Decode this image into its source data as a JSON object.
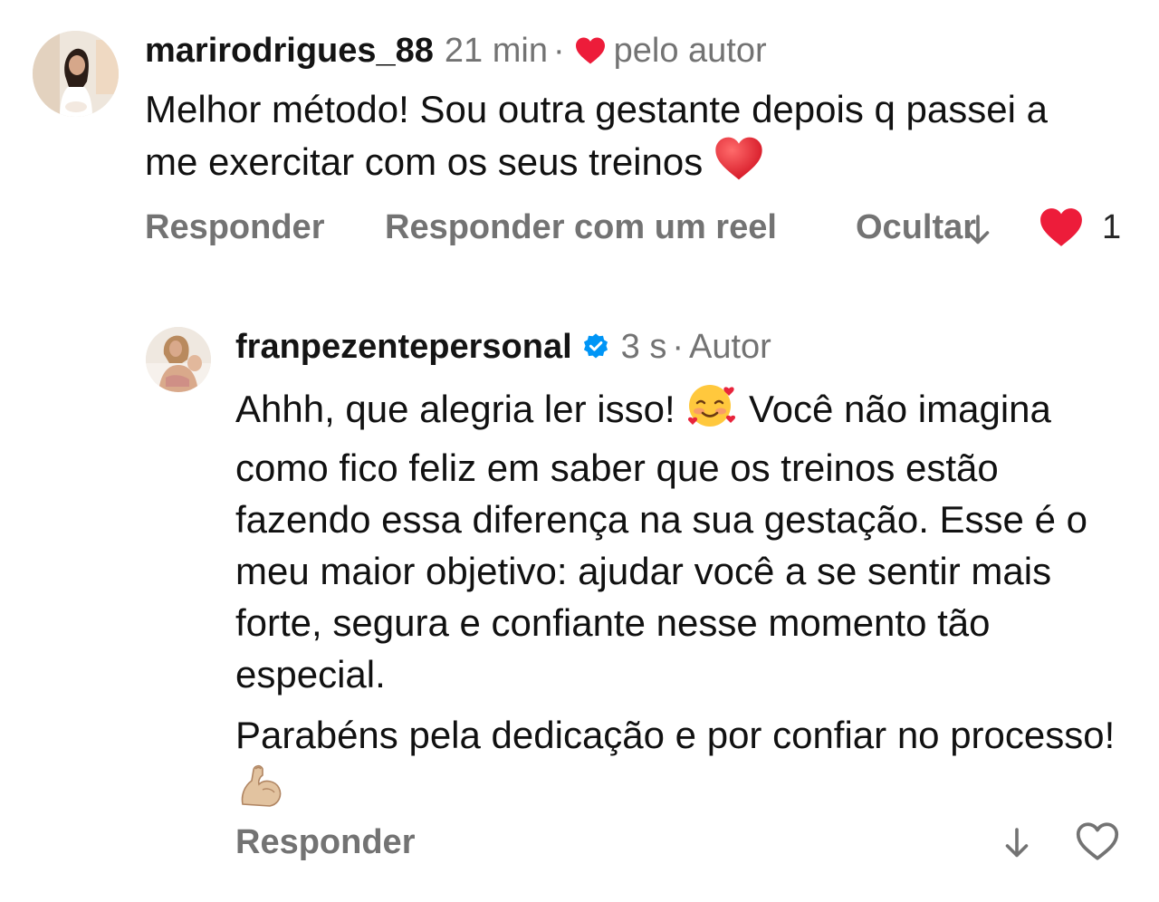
{
  "colors": {
    "text": "#111111",
    "muted": "#737373",
    "like_red": "#ED1C3A",
    "verified_blue": "#0095F6"
  },
  "comments": [
    {
      "username": "marirodrigues_88",
      "time": "21 min",
      "separator": "·",
      "liked_by_author_icon": "heart-icon",
      "liked_by_author_label": "pelo autor",
      "text_line_1": "Melhor método! Sou outra gestante depois q passei a me exercitar com os seus treinos",
      "emoji": "red-heart-emoji",
      "actions": {
        "reply": "Responder",
        "reply_reel": "Responder com um reel",
        "hide": "Ocultar"
      },
      "likes": "1",
      "liked": true
    },
    {
      "username": "franpezentepersonal",
      "verified": true,
      "time": "3 s",
      "separator": "·",
      "author_label": "Autor",
      "paragraph_1_a": "Ahhh, que alegria ler isso!",
      "paragraph_1_b": "Você não imagina como fico feliz em saber que os treinos estão fazendo essa diferença na sua gestação. Esse é o meu maior objetivo: ajudar você a se sentir mais forte, segura e confiante nesse momento tão especial.",
      "paragraph_2": "Parabéns pela dedicação e por confiar no processo!",
      "emoji_1": "smiling-face-with-hearts-emoji",
      "emoji_2": "flexed-biceps-emoji",
      "actions": {
        "reply": "Responder"
      },
      "liked": false
    }
  ]
}
